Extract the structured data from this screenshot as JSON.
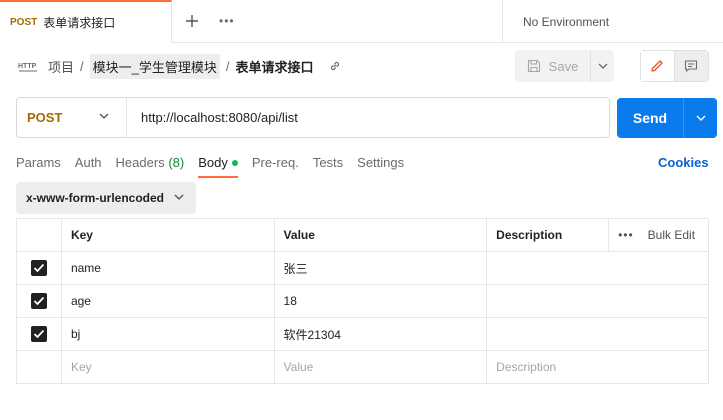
{
  "tab": {
    "method": "POST",
    "name": "表单请求接口",
    "more": "•••"
  },
  "environment": {
    "label": "No Environment"
  },
  "breadcrumb": {
    "project": "项目",
    "separator": "/",
    "folder": "模块一_学生管理模块",
    "current": "表单请求接口"
  },
  "toolbar": {
    "save_label": "Save"
  },
  "request": {
    "method": "POST",
    "url": "http://localhost:8080/api/list",
    "send_label": "Send"
  },
  "request_tabs": [
    {
      "label": "Params"
    },
    {
      "label": "Auth"
    },
    {
      "label": "Headers",
      "count": "(8)"
    },
    {
      "label": "Body"
    },
    {
      "label": "Pre-req."
    },
    {
      "label": "Tests"
    },
    {
      "label": "Settings"
    }
  ],
  "cookies_label": "Cookies",
  "body_type": "x-www-form-urlencoded",
  "table": {
    "headers": {
      "key": "Key",
      "value": "Value",
      "description": "Description",
      "bulk_edit": "Bulk Edit",
      "bulk_dots": "•••"
    },
    "rows": [
      {
        "checked": true,
        "key": "name",
        "value": "张三",
        "description": ""
      },
      {
        "checked": true,
        "key": "age",
        "value": "18",
        "description": ""
      },
      {
        "checked": true,
        "key": "bj",
        "value": "软件21304",
        "description": ""
      }
    ],
    "placeholders": {
      "key": "Key",
      "value": "Value",
      "description": "Description"
    }
  },
  "colors": {
    "accent": "#ff6c37",
    "send_button": "#097bed",
    "method_post": "#a66b00",
    "link": "#0265d2",
    "status_dot": "#0cbb52"
  },
  "icons": [
    "plus-icon",
    "http-icon",
    "link-icon",
    "save-icon",
    "chevron-down-icon",
    "edit-pencil-icon",
    "comment-icon",
    "checkbox-checked-icon"
  ]
}
